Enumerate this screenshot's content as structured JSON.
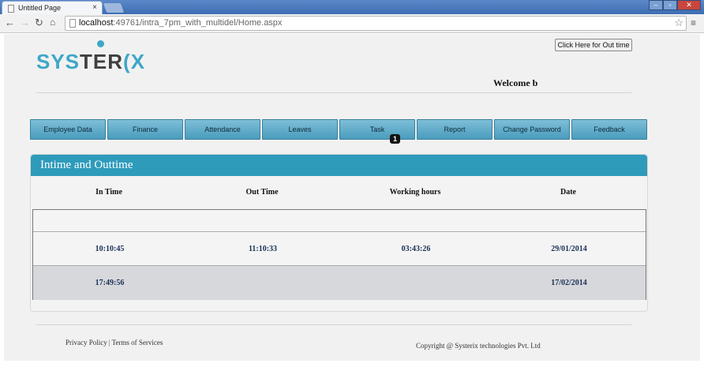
{
  "browser": {
    "tab_title": "Untitled Page",
    "tab_close": "×",
    "url_host": "localhost",
    "url_path": ":49761/intra_7pm_with_multidel/Home.aspx",
    "win_min": "–",
    "win_max": "▫",
    "win_close": "✕"
  },
  "header": {
    "logo_part1": "SYS",
    "logo_part2": "TER",
    "logo_part3": "(X",
    "outtime_button": "Click Here for Out time",
    "welcome": "Welcome b"
  },
  "menu": {
    "items": [
      "Employee  Data",
      "Finance",
      "Attendance",
      "Leaves",
      "Task",
      "Report",
      "Change Password",
      "Feedback"
    ],
    "task_badge": "1"
  },
  "panel": {
    "title": "Intime and Outtime",
    "columns": [
      "In Time",
      "Out Time",
      "Working hours",
      "Date"
    ],
    "rows": [
      [
        "",
        "",
        "",
        ""
      ],
      [
        "10:10:45",
        "11:10:33",
        "03:43:26",
        "29/01/2014"
      ],
      [
        "17:49:56",
        "",
        "",
        "17/02/2014"
      ]
    ]
  },
  "footer": {
    "privacy": "Privacy Policy",
    "separator": "|",
    "terms": "Terms of Services",
    "copyright": "Copyright @ Systerix technologies Pvt. Ltd"
  },
  "colors": {
    "accent": "#2e9bbb",
    "menu_button": "#5aa9c8",
    "logo_blue": "#3ea7c8",
    "logo_dark": "#3f3f3f"
  }
}
